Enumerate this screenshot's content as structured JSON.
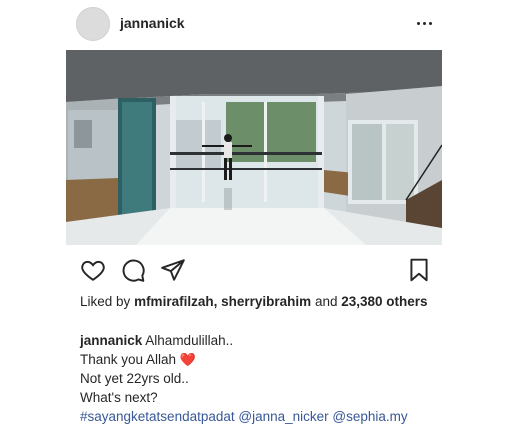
{
  "post": {
    "username": "jannanick",
    "likes": {
      "prefix": "Liked by",
      "user1": "mfmirafilzah",
      "separator": ",",
      "user2": "sherryibrahim",
      "and": "and",
      "count": "23,380",
      "suffix": "others"
    },
    "caption": {
      "username": "jannanick",
      "line1": "Alhamdulillah..",
      "line2": "Thank you Allah",
      "line2_emoji": "❤️",
      "line3": "Not yet 22yrs old..",
      "line4": "What's next?",
      "hashtag": "#sayangketatsendatpadat",
      "mention1": "@janna_nicker",
      "mention2": "@sephia.my"
    },
    "icons": {
      "more": "more-options-icon",
      "like": "heart-icon",
      "comment": "comment-icon",
      "share": "share-icon",
      "save": "bookmark-icon"
    }
  }
}
